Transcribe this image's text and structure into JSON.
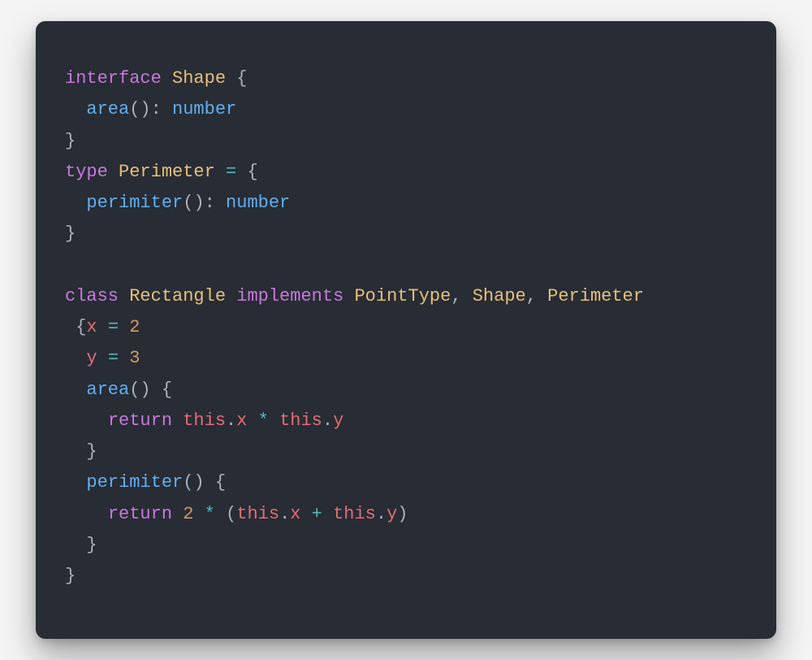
{
  "code": {
    "kw_interface": "interface",
    "kw_type": "type",
    "kw_class": "class",
    "kw_implements": "implements",
    "kw_return1": "return",
    "kw_return2": "return",
    "type_Shape": "Shape",
    "type_Perimeter": "Perimeter",
    "type_Rectangle": "Rectangle",
    "type_PointType": "PointType",
    "type_Shape2": "Shape",
    "type_Perimeter2": "Perimeter",
    "fn_area_decl": "area",
    "fn_perimiter_decl": "perimiter",
    "fn_area_impl": "area",
    "fn_perimiter_impl": "perimiter",
    "prim_number1": "number",
    "prim_number2": "number",
    "prop_x": "x",
    "prop_y": "y",
    "num_2": "2",
    "num_3": "3",
    "num_2b": "2",
    "this1": "this",
    "this2": "this",
    "this3": "this",
    "this4": "this",
    "mem_x1": "x",
    "mem_y1": "y",
    "mem_x2": "x",
    "mem_y2": "y",
    "sp": " ",
    "lbrace": "{",
    "rbrace": "}",
    "lparen": "(",
    "rparen": ")",
    "colon": ":",
    "comma": ",",
    "dot": ".",
    "eq": "=",
    "star": "*",
    "plus": "+"
  }
}
